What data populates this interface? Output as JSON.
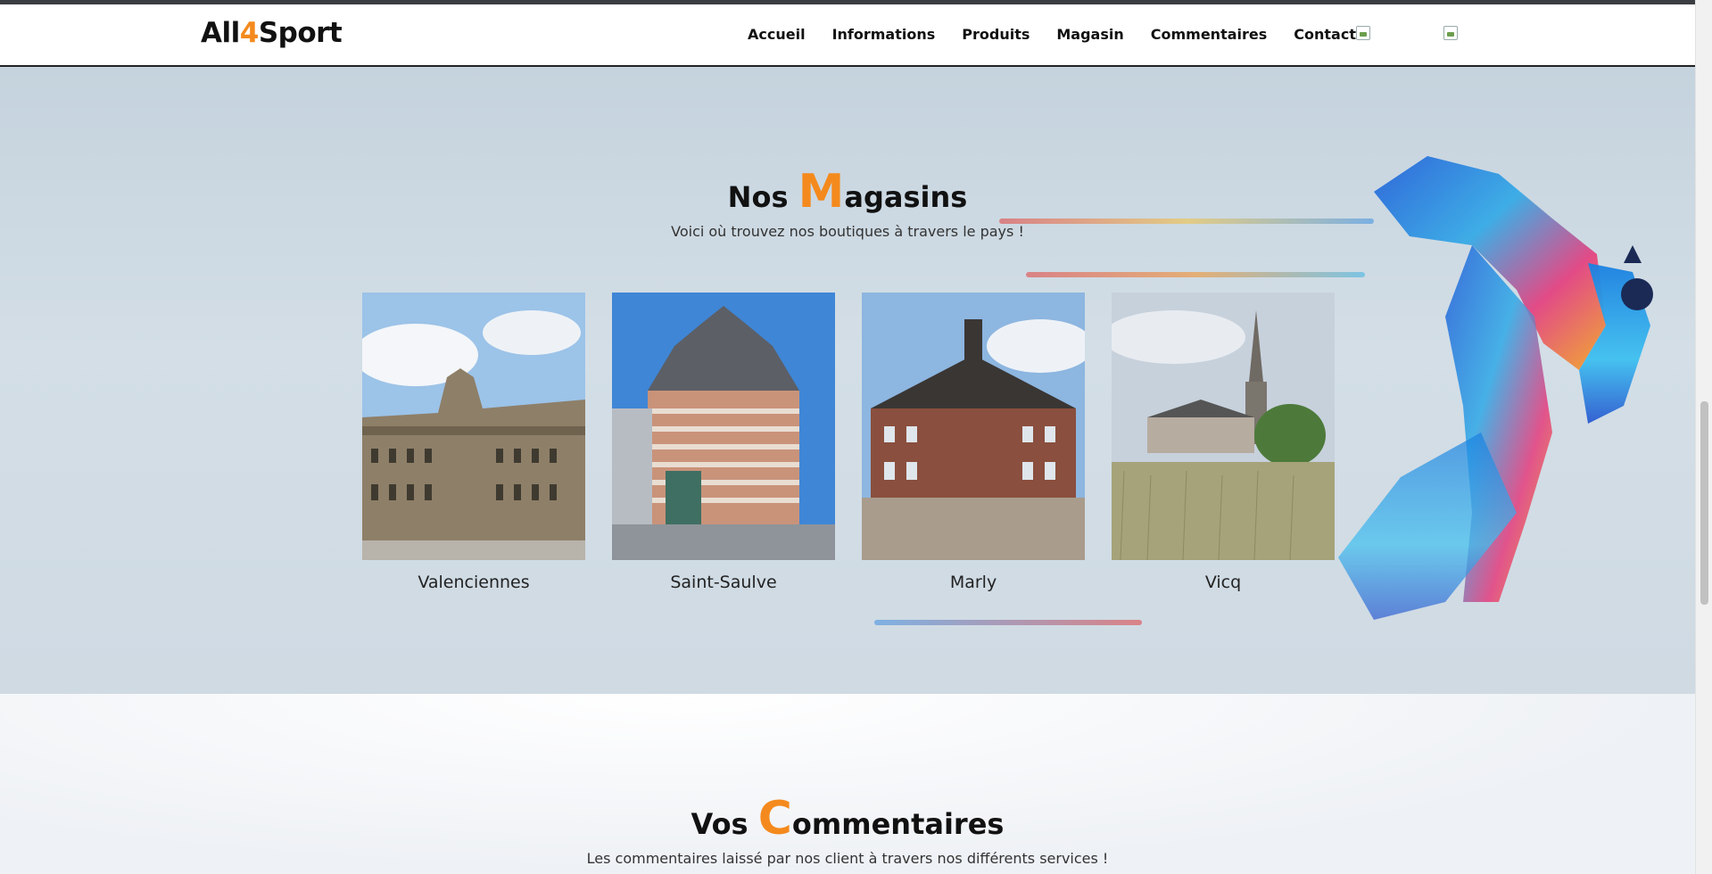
{
  "brand": {
    "prefix": "All",
    "accent": "4",
    "suffix": "Sport",
    "accent_color": "#f48a1d"
  },
  "nav": {
    "links": [
      "Accueil",
      "Informations",
      "Produits",
      "Magasin",
      "Commentaires",
      "Contact"
    ],
    "images": [
      "broken-image-icon",
      "broken-image-icon"
    ]
  },
  "shops": {
    "title_pre": "Nos ",
    "title_initial": "M",
    "title_rest": "agasins",
    "subtitle": "Voici où trouvez nos boutiques à travers le pays !",
    "stores": [
      {
        "name": "Valenciennes"
      },
      {
        "name": "Saint-Saulve"
      },
      {
        "name": "Marly"
      },
      {
        "name": "Vicq"
      }
    ]
  },
  "comments": {
    "title_pre": "Vos ",
    "title_initial": "C",
    "title_rest": "ommentaires",
    "subtitle": "Les commentaires laissé par nos client à travers nos différents services !"
  }
}
